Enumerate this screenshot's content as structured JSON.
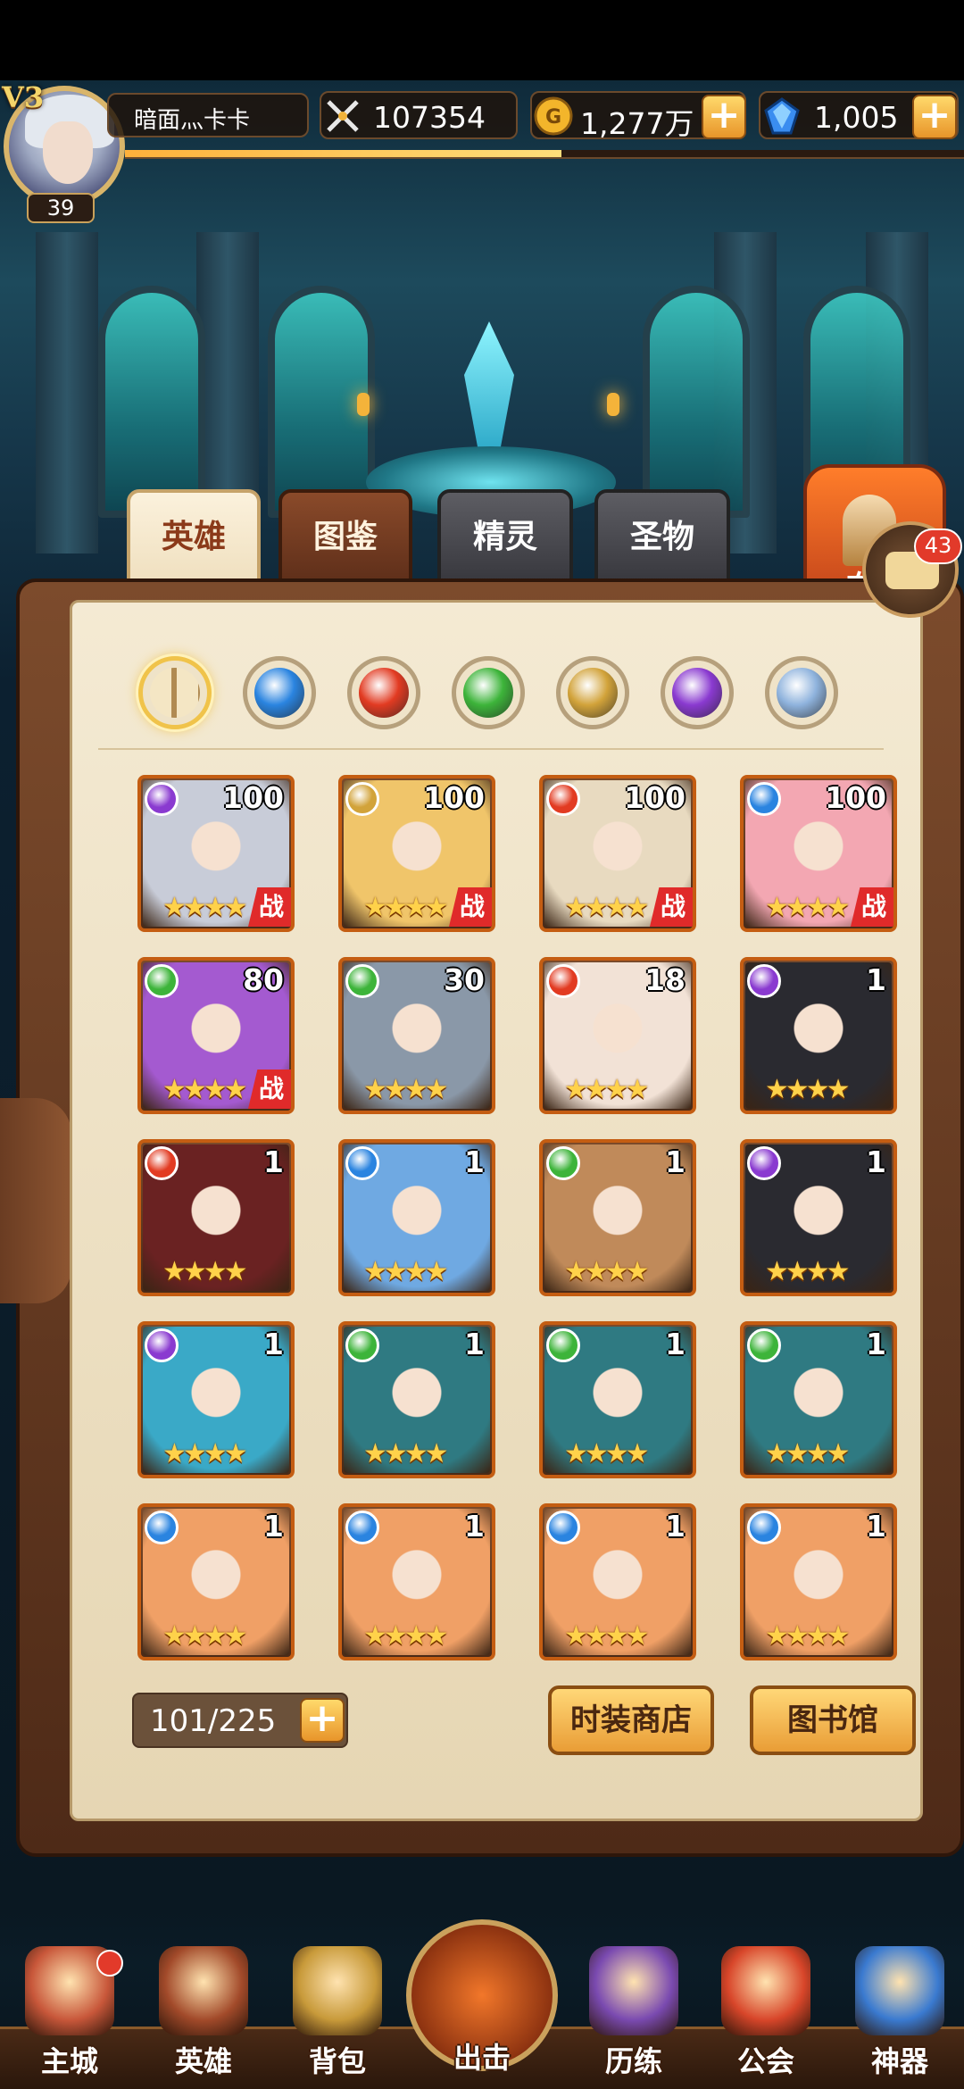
{
  "player": {
    "vip": "V3",
    "level": "39",
    "name": "暗面灬卡卡",
    "power": "107354",
    "gold": "1,277万",
    "gems": "1,005",
    "xp_fraction": 0.52
  },
  "tabs": [
    {
      "label": "英雄",
      "active": true
    },
    {
      "label": "图鉴",
      "active": false
    },
    {
      "label": "精灵",
      "active": false
    },
    {
      "label": "圣物",
      "active": false
    }
  ],
  "formation": {
    "label": "布"
  },
  "chat": {
    "badge": "43"
  },
  "filters": [
    {
      "name": "all",
      "color": "#b9a27a",
      "active": true
    },
    {
      "name": "water",
      "color": "#2a84e0"
    },
    {
      "name": "fire",
      "color": "#e23b22"
    },
    {
      "name": "wind",
      "color": "#3db43a"
    },
    {
      "name": "light",
      "color": "#d2a33a"
    },
    {
      "name": "dark",
      "color": "#8a3ad0"
    },
    {
      "name": "void",
      "color": "#8fb3dd"
    }
  ],
  "heroes": [
    {
      "level": "100",
      "element": "dark",
      "tag": "战",
      "color": "#c8ccd8"
    },
    {
      "level": "100",
      "element": "light",
      "tag": "战",
      "color": "#f0c56a"
    },
    {
      "level": "100",
      "element": "fire",
      "tag": "战",
      "color": "#e8dac0"
    },
    {
      "level": "100",
      "element": "water",
      "tag": "战",
      "color": "#f3a7b2"
    },
    {
      "level": "80",
      "element": "wind",
      "tag": "战",
      "color": "#a45ad0"
    },
    {
      "level": "30",
      "element": "wind",
      "tag": "",
      "color": "#8a98a8"
    },
    {
      "level": "18",
      "element": "fire",
      "tag": "",
      "color": "#f2e2d6"
    },
    {
      "level": "1",
      "element": "dark",
      "tag": "",
      "color": "#2a2a30"
    },
    {
      "level": "1",
      "element": "fire",
      "tag": "",
      "color": "#6a2222"
    },
    {
      "level": "1",
      "element": "water",
      "tag": "",
      "color": "#6fa9e2"
    },
    {
      "level": "1",
      "element": "wind",
      "tag": "",
      "color": "#c08a5a"
    },
    {
      "level": "1",
      "element": "dark",
      "tag": "",
      "color": "#2a2a30"
    },
    {
      "level": "1",
      "element": "dark",
      "tag": "",
      "color": "#3aa9c7"
    },
    {
      "level": "1",
      "element": "wind",
      "tag": "",
      "color": "#2f7a82"
    },
    {
      "level": "1",
      "element": "wind",
      "tag": "",
      "color": "#2f7a82"
    },
    {
      "level": "1",
      "element": "wind",
      "tag": "",
      "color": "#2f7a82"
    },
    {
      "level": "1",
      "element": "water",
      "tag": "",
      "color": "#f0a066"
    },
    {
      "level": "1",
      "element": "water",
      "tag": "",
      "color": "#f0a066"
    },
    {
      "level": "1",
      "element": "water",
      "tag": "",
      "color": "#f0a066"
    },
    {
      "level": "1",
      "element": "water",
      "tag": "",
      "color": "#f0a066"
    }
  ],
  "hero_stars": "★★★★",
  "capacity": "101/225",
  "buttons": {
    "fashion_shop": "时装商店",
    "library": "图书馆"
  },
  "nav": [
    {
      "label": "主城",
      "icon": "castle-icon"
    },
    {
      "label": "英雄",
      "icon": "hero-icon"
    },
    {
      "label": "背包",
      "icon": "bag-icon"
    },
    {
      "label": "出击",
      "icon": "crossed-swords-icon"
    },
    {
      "label": "历练",
      "icon": "tower-icon"
    },
    {
      "label": "公会",
      "icon": "guild-shield-icon"
    },
    {
      "label": "神器",
      "icon": "artifact-crystal-icon"
    }
  ]
}
